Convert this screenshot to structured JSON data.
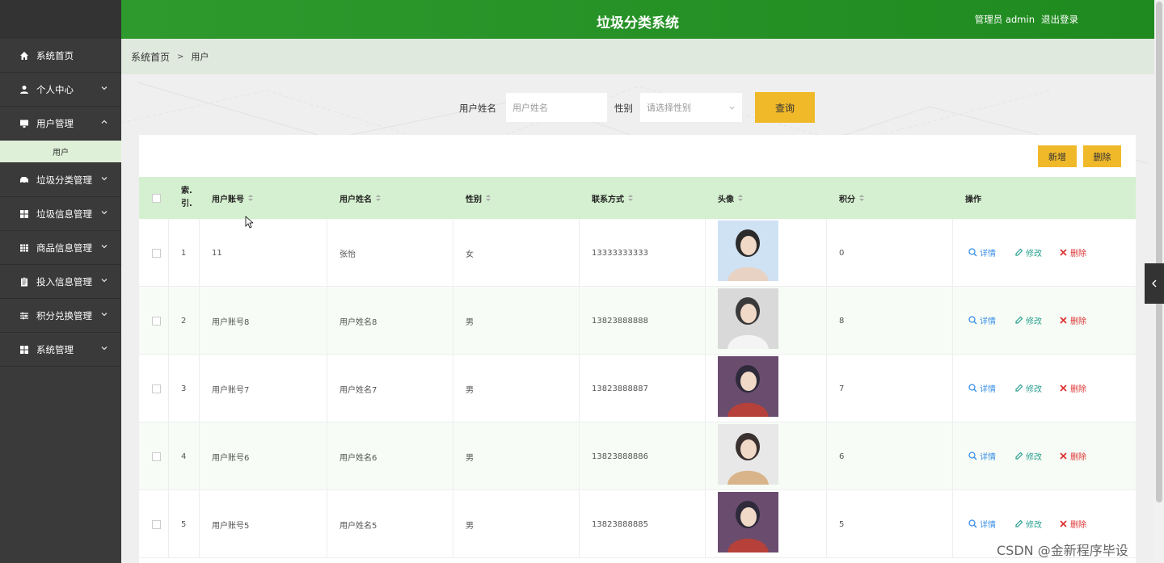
{
  "app": {
    "title": "垃圾分类系统",
    "user_label": "管理员 admin",
    "logout_label": "退出登录"
  },
  "sidebar": {
    "items": [
      {
        "label": "系统首页",
        "icon": "home-icon"
      },
      {
        "label": "个人中心",
        "icon": "person-icon"
      },
      {
        "label": "用户管理",
        "icon": "monitor-icon",
        "sub": "用户"
      },
      {
        "label": "垃圾分类管理",
        "icon": "car-icon"
      },
      {
        "label": "垃圾信息管理",
        "icon": "grid-icon"
      },
      {
        "label": "商品信息管理",
        "icon": "table-icon"
      },
      {
        "label": "投入信息管理",
        "icon": "clipboard-icon"
      },
      {
        "label": "积分兑换管理",
        "icon": "sliders-icon"
      },
      {
        "label": "系统管理",
        "icon": "grid-icon"
      }
    ]
  },
  "breadcrumb": {
    "home": "系统首页",
    "sep": ">",
    "current": "用户"
  },
  "search": {
    "name_label": "用户姓名",
    "name_placeholder": "用户姓名",
    "gender_label": "性别",
    "gender_placeholder": "请选择性别",
    "query_label": "查询"
  },
  "toolbar": {
    "add_label": "新增",
    "delete_label": "删除"
  },
  "table": {
    "headers": {
      "index": "索.\n引.",
      "account": "用户账号",
      "name": "用户姓名",
      "gender": "性别",
      "phone": "联系方式",
      "avatar": "头像",
      "points": "积分",
      "ops": "操作"
    },
    "actions": {
      "detail": "详情",
      "edit": "修改",
      "delete": "删除"
    },
    "rows": [
      {
        "index": "1",
        "account": "11",
        "name": "张怡",
        "gender": "女",
        "phone": "13333333333",
        "points": "0"
      },
      {
        "index": "2",
        "account": "用户账号8",
        "name": "用户姓名8",
        "gender": "男",
        "phone": "13823888888",
        "points": "8"
      },
      {
        "index": "3",
        "account": "用户账号7",
        "name": "用户姓名7",
        "gender": "男",
        "phone": "13823888887",
        "points": "7"
      },
      {
        "index": "4",
        "account": "用户账号6",
        "name": "用户姓名6",
        "gender": "男",
        "phone": "13823888886",
        "points": "6"
      },
      {
        "index": "5",
        "account": "用户账号5",
        "name": "用户姓名5",
        "gender": "男",
        "phone": "13823888885",
        "points": "5"
      }
    ]
  },
  "watermark": "CSDN @金新程序毕设"
}
